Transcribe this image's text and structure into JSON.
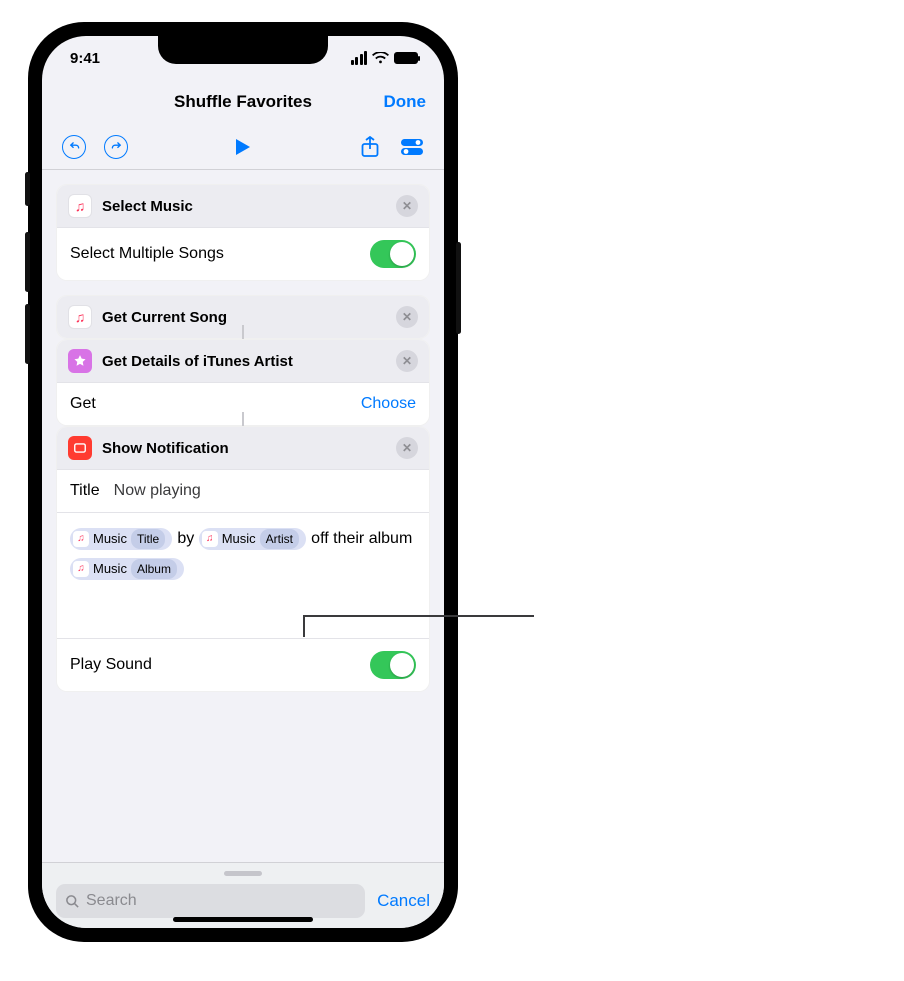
{
  "status": {
    "time": "9:41"
  },
  "nav": {
    "title": "Shuffle Favorites",
    "done": "Done"
  },
  "toolbar": {
    "undo_name": "undo-icon",
    "redo_name": "redo-icon",
    "play_name": "play-icon",
    "share_name": "share-icon",
    "settings_name": "settings-icon"
  },
  "actions": [
    {
      "id": "select-music",
      "icon": "music",
      "title": "Select Music",
      "rows": [
        {
          "kind": "toggle",
          "label": "Select Multiple Songs",
          "on": true
        }
      ]
    },
    {
      "id": "get-current-song",
      "icon": "music",
      "title": "Get Current Song",
      "rows": []
    },
    {
      "id": "get-details-itunes-artist",
      "icon": "star",
      "title": "Get Details of iTunes Artist",
      "rows": [
        {
          "kind": "choose",
          "label": "Get",
          "link": "Choose"
        }
      ],
      "connected_above": true
    },
    {
      "id": "show-notification",
      "icon": "notif",
      "title": "Show Notification",
      "connected_above": true,
      "title_row": {
        "label": "Title",
        "value": "Now playing"
      },
      "body": {
        "tokens": [
          {
            "type": "var",
            "source": "Music",
            "attr": "Title"
          },
          {
            "type": "text",
            "value": " by "
          },
          {
            "type": "var",
            "source": "Music",
            "attr": "Artist"
          },
          {
            "type": "text",
            "value": " off their album "
          },
          {
            "type": "var",
            "source": "Music",
            "attr": "Album"
          }
        ]
      },
      "rows": [
        {
          "kind": "toggle",
          "label": "Play Sound",
          "on": true
        }
      ]
    }
  ],
  "footer": {
    "search_placeholder": "Search",
    "cancel": "Cancel"
  }
}
